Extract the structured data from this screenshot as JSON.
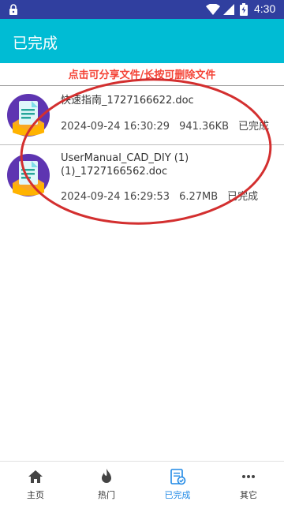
{
  "status_bar": {
    "time": "4:30",
    "icons": [
      "lock-icon",
      "wifi-icon",
      "signal-icon",
      "battery-icon"
    ]
  },
  "app_bar": {
    "title": "已完成"
  },
  "hint": {
    "text": "点击可分享文件/长按可删除文件"
  },
  "files": [
    {
      "name": "快速指南_1727166622.doc",
      "date": "2024-09-24 16:30:29",
      "size": "941.36KB",
      "status": "已完成",
      "icon": "doc-file-icon"
    },
    {
      "name": "UserManual_CAD_DIY (1) (1)_1727166562.doc",
      "date": "2024-09-24 16:29:53",
      "size": "6.27MB",
      "status": "已完成",
      "icon": "doc-file-icon"
    }
  ],
  "bottom_nav": {
    "items": [
      {
        "label": "主页",
        "icon": "home-icon",
        "active": false
      },
      {
        "label": "热门",
        "icon": "flame-icon",
        "active": false
      },
      {
        "label": "已完成",
        "icon": "completed-doc-icon",
        "active": true
      },
      {
        "label": "其它",
        "icon": "more-icon",
        "active": false
      }
    ]
  },
  "colors": {
    "status_bar": "#303f9f",
    "app_bar": "#00bcd4",
    "hint_text": "#f44336",
    "active_nav": "#1e88e5",
    "annotation": "#d32f2f"
  }
}
